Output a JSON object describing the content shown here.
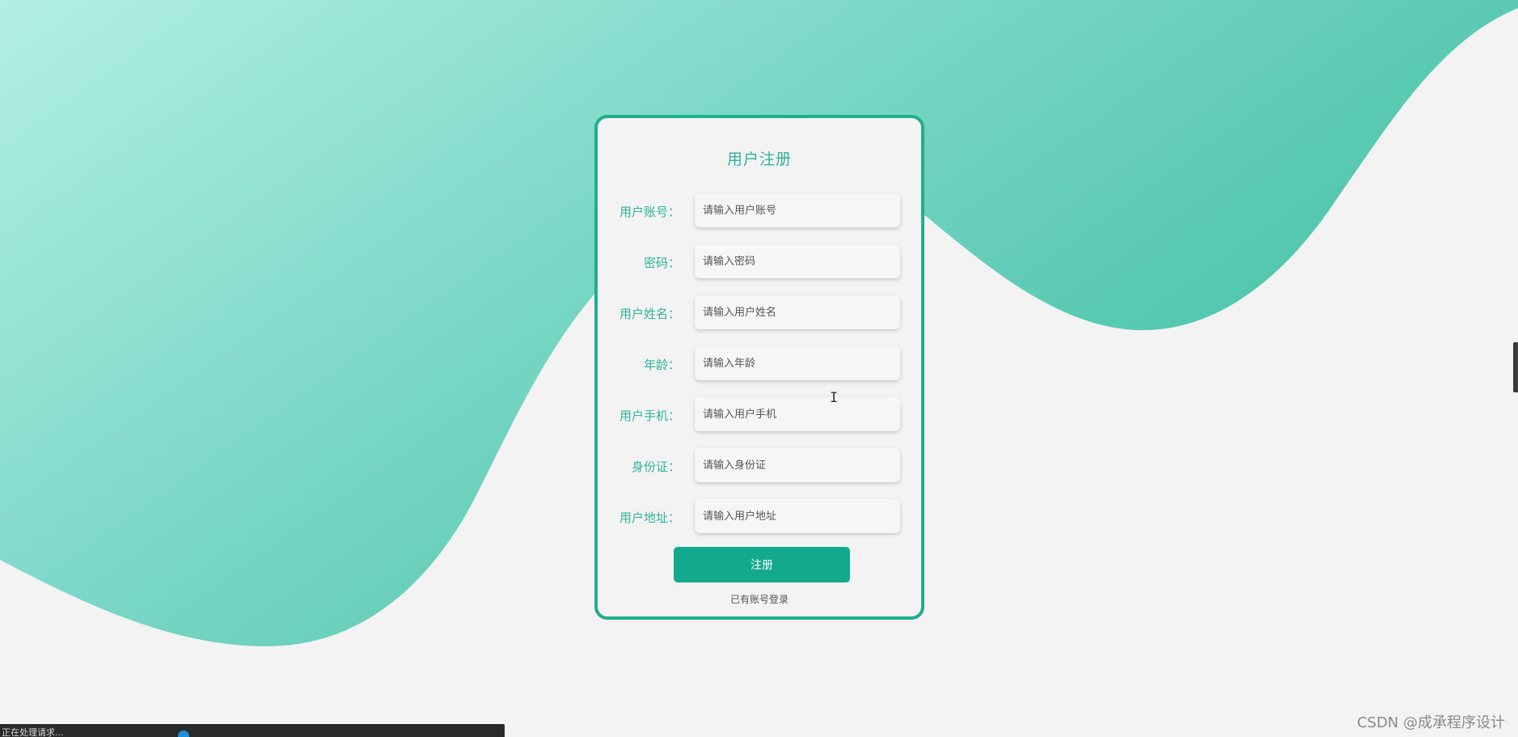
{
  "colors": {
    "accent": "#2fb39a",
    "button": "#13a98d",
    "card_border": "#1fae8e",
    "background": "#f3f3f3",
    "wave_light": "#b3efe6",
    "wave_dark": "#3fbfa3"
  },
  "form": {
    "title": "用户注册",
    "fields": [
      {
        "label": "用户账号：",
        "placeholder": "请输入用户账号"
      },
      {
        "label": "密码：",
        "placeholder": "请输入密码"
      },
      {
        "label": "用户姓名：",
        "placeholder": "请输入用户姓名"
      },
      {
        "label": "年龄：",
        "placeholder": "请输入年龄"
      },
      {
        "label": "用户手机：",
        "placeholder": "请输入用户手机"
      },
      {
        "label": "身份证：",
        "placeholder": "请输入身份证"
      },
      {
        "label": "用户地址：",
        "placeholder": "请输入用户地址"
      }
    ],
    "submit_label": "注册",
    "login_link": "已有账号登录"
  },
  "status": {
    "text": "正在处理请求..."
  },
  "watermark": "CSDN @成承程序设计",
  "icons": {
    "cursor": "text-cursor-icon"
  }
}
